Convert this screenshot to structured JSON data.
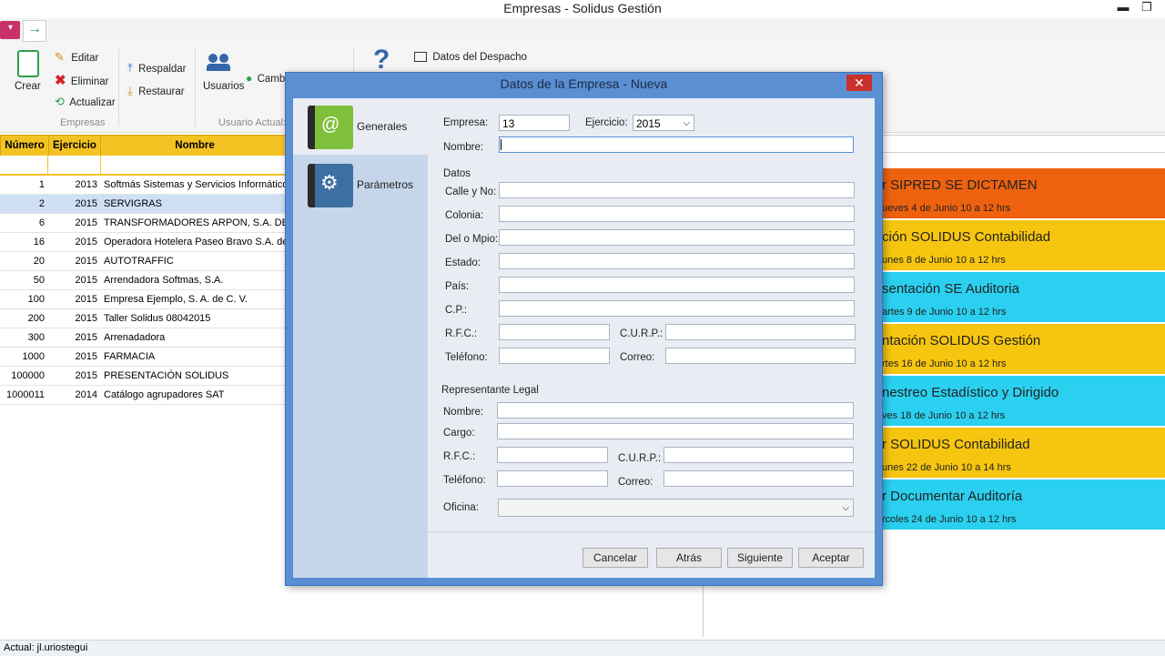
{
  "window": {
    "title": "Empresas - Solidus Gestión",
    "minimize": "▬",
    "restore": "❐"
  },
  "ribbon": {
    "crear": "Crear",
    "editar": "Editar",
    "eliminar": "Eliminar",
    "actualizar": "Actualizar",
    "group_empresas": "Empresas",
    "respaldar": "Respaldar",
    "restaurar": "Restaurar",
    "usuarios": "Usuarios",
    "cambiar": "Camb",
    "group_usuario": "Usuario Actual:",
    "ayuda": "?",
    "datos_despacho": "Datos del Despacho"
  },
  "grid": {
    "headers": [
      "Número",
      "Ejercicio",
      "Nombre"
    ],
    "rows": [
      {
        "numero": "1",
        "ejercicio": "2013",
        "nombre": "Softmás Sistemas y Servicios Informáticos,"
      },
      {
        "numero": "2",
        "ejercicio": "2015",
        "nombre": "SERVIGRAS"
      },
      {
        "numero": "6",
        "ejercicio": "2015",
        "nombre": "TRANSFORMADORES ARPON, S.A. DE C"
      },
      {
        "numero": "16",
        "ejercicio": "2015",
        "nombre": "Operadora Hotelera Paseo Bravo S.A. de C"
      },
      {
        "numero": "20",
        "ejercicio": "2015",
        "nombre": "AUTOTRAFFIC"
      },
      {
        "numero": "50",
        "ejercicio": "2015",
        "nombre": "Arrendadora Softmas, S.A."
      },
      {
        "numero": "100",
        "ejercicio": "2015",
        "nombre": "Empresa Ejemplo, S. A. de C. V."
      },
      {
        "numero": "200",
        "ejercicio": "2015",
        "nombre": "Taller Solidus 08042015"
      },
      {
        "numero": "300",
        "ejercicio": "2015",
        "nombre": "Arrenadadora"
      },
      {
        "numero": "1000",
        "ejercicio": "2015",
        "nombre": "FARMACIA"
      },
      {
        "numero": "100000",
        "ejercicio": "2015",
        "nombre": "PRESENTACIÓN SOLIDUS"
      },
      {
        "numero": "1000011",
        "ejercicio": "2014",
        "nombre": "Catálogo agrupadores SAT"
      }
    ]
  },
  "events": [
    {
      "title": "r SIPRED SE DICTAMEN",
      "date": "ueves 4 de Junio 10 a 12 hrs",
      "color": "#ee620f"
    },
    {
      "title": "ción SOLIDUS Contabilidad",
      "date": "unes 8 de Junio 10 a 12 hrs",
      "color": "#f6c50f"
    },
    {
      "title": "sentación SE Auditoria",
      "date": "artes 9 de Junio 10 a 12 hrs",
      "color": "#2bd0f0"
    },
    {
      "title": "ntación SOLIDUS Gestión",
      "date": "rtes 16 de Junio 10 a 12 hrs",
      "color": "#f6c50f"
    },
    {
      "title": "nestreo Estadístico y Dirigido",
      "date": "ves 18 de Junio 10 a 12 hrs",
      "color": "#2bd0f0"
    },
    {
      "title": "r SOLIDUS Contabilidad",
      "date": "unes 22 de Junio 10 a 14 hrs",
      "color": "#f6c50f"
    },
    {
      "title": "r Documentar Auditoría",
      "date": "rcoles 24 de Junio 10 a 12 hrs",
      "color": "#2bd0f0"
    }
  ],
  "status": {
    "text": "Actual: jl.uriostegui"
  },
  "dialog": {
    "title": "Datos de la Empresa - Nueva",
    "close": "✕",
    "side": {
      "generales": "Generales",
      "parametros": "Parámetros"
    },
    "empresa_label": "Empresa:",
    "empresa_value": "13",
    "ejercicio_label": "Ejercicio:",
    "ejercicio_value": "2015",
    "nombre_label": "Nombre:",
    "nombre_value": "",
    "datos_section": "Datos",
    "calle_label": "Calle y No:",
    "colonia_label": "Colonia:",
    "delmpio_label": "Del o Mpio:",
    "estado_label": "Estado:",
    "pais_label": "País:",
    "cp_label": "C.P.:",
    "rfc_label": "R.F.C.:",
    "curp_label": "C.U.R.P.:",
    "telefono_label": "Teléfono:",
    "correo_label": "Correo:",
    "rep_section": "Representante Legal",
    "rep_nombre_label": "Nombre:",
    "rep_cargo_label": "Cargo:",
    "rep_rfc_label": "R.F.C.:",
    "rep_curp_label": "C.U.R.P.:",
    "rep_telefono_label": "Teléfono:",
    "rep_correo_label": "Correo:",
    "oficina_label": "Oficina:",
    "oficina_value": "",
    "buttons": {
      "cancelar": "Cancelar",
      "atras": "Atrás",
      "siguiente": "Siguiente",
      "aceptar": "Aceptar"
    }
  }
}
